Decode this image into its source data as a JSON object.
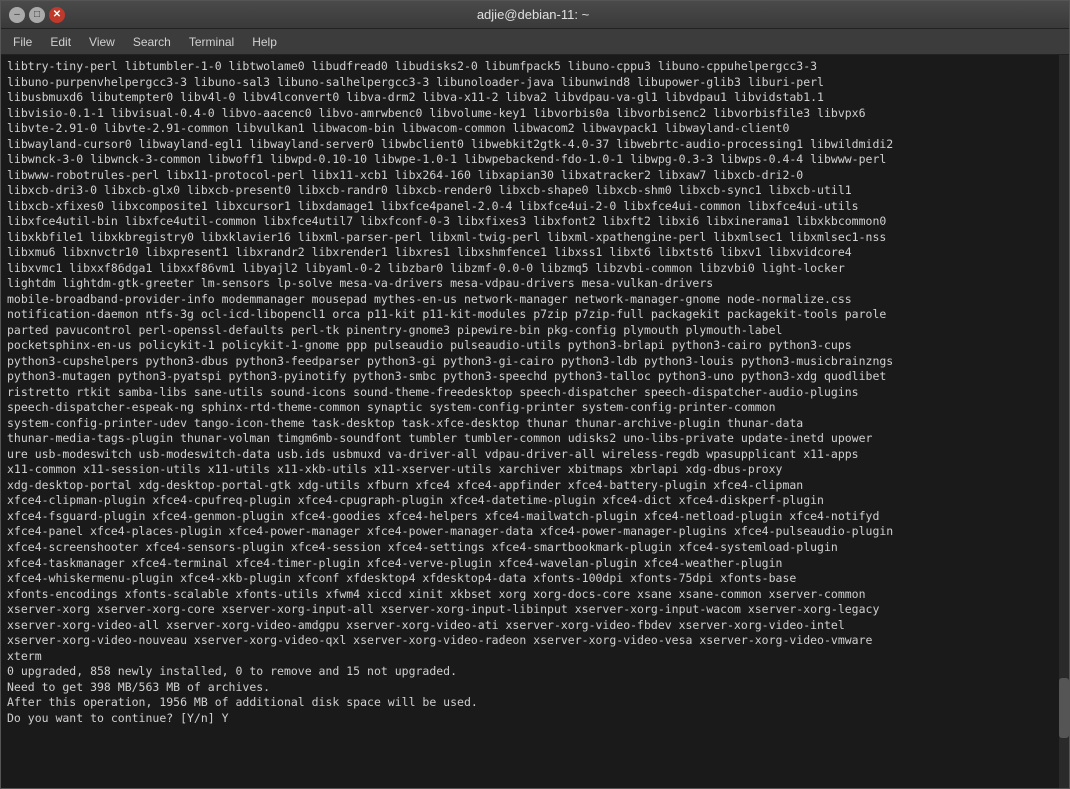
{
  "window": {
    "title": "adjie@debian-11: ~",
    "buttons": {
      "minimize": "–",
      "maximize": "□",
      "close": "✕"
    }
  },
  "menubar": {
    "items": [
      "File",
      "Edit",
      "View",
      "Search",
      "Terminal",
      "Help"
    ]
  },
  "terminal": {
    "content": "libtry-tiny-perl libtumbler-1-0 libtwolame0 libudfread0 libudisks2-0 libumfpack5 libuno-cppu3 libuno-cppuhelpergcc3-3\nlibuno-purpenvhelpergcc3-3 libuno-sal3 libuno-salhelpergcc3-3 libunoloader-java libunwind8 libupower-glib3 liburi-perl\nlibusbmuxd6 libutempter0 libv4l-0 libv4lconvert0 libva-drm2 libva-x11-2 libva2 libvdpau-va-gl1 libvdpau1 libvidstab1.1\nlibvisio-0.1-1 libvisual-0.4-0 libvo-aacenc0 libvo-amrwbenc0 libvolume-key1 libvorbis0a libvorbisenc2 libvorbisfile3 libvpx6\nlibvte-2.91-0 libvte-2.91-common libvulkan1 libwacom-bin libwacom-common libwacom2 libwavpack1 libwayland-client0\nlibwayland-cursor0 libwayland-egl1 libwayland-server0 libwbclient0 libwebkit2gtk-4.0-37 libwebrtc-audio-processing1 libwildmidi2\nlibwnck-3-0 libwnck-3-common libwoff1 libwpd-0.10-10 libwpe-1.0-1 libwpebackend-fdo-1.0-1 libwpg-0.3-3 libwps-0.4-4 libwww-perl\nlibwww-robotrules-perl libx11-protocol-perl libx11-xcb1 libx264-160 libxapian30 libxatracker2 libxaw7 libxcb-dri2-0\nlibxcb-dri3-0 libxcb-glx0 libxcb-present0 libxcb-randr0 libxcb-render0 libxcb-shape0 libxcb-shm0 libxcb-sync1 libxcb-util1\nlibxcb-xfixes0 libxcomposite1 libxcursor1 libxdamage1 libxfce4panel-2.0-4 libxfce4ui-2-0 libxfce4ui-common libxfce4ui-utils\nlibxfce4util-bin libxfce4util-common libxfce4util7 libxfconf-0-3 libxfixes3 libxfont2 libxft2 libxi6 libxinerama1 libxkbcommon0\nlibxkbfile1 libxkbregistry0 libxklavier16 libxml-parser-perl libxml-twig-perl libxml-xpathengine-perl libxmlsec1 libxmlsec1-nss\nlibxmu6 libxnvctr10 libxpresent1 libxrandr2 libxrender1 libxres1 libxshmfence1 libxss1 libxt6 libxtst6 libxv1 libxvidcore4\nlibxvmc1 libxxf86dga1 libxxf86vm1 libyajl2 libyaml-0-2 libzbar0 libzmf-0.0-0 libzmq5 libzvbi-common libzvbi0 light-locker\nlightdm lightdm-gtk-greeter lm-sensors lp-solve mesa-va-drivers mesa-vdpau-drivers mesa-vulkan-drivers\nmobile-broadband-provider-info modemmanager mousepad mythes-en-us network-manager network-manager-gnome node-normalize.css\nnotification-daemon ntfs-3g ocl-icd-libopencl1 orca p11-kit p11-kit-modules p7zip p7zip-full packagekit packagekit-tools parole\nparted pavucontrol perl-openssl-defaults perl-tk pinentry-gnome3 pipewire-bin pkg-config plymouth plymouth-label\npocketsphinx-en-us policykit-1 policykit-1-gnome ppp pulseaudio pulseaudio-utils python3-brlapi python3-cairo python3-cups\npython3-cupshelpers python3-dbus python3-feedparser python3-gi python3-gi-cairo python3-ldb python3-louis python3-musicbrainzngs\npython3-mutagen python3-pyatspi python3-pyinotify python3-smbc python3-speechd python3-talloc python3-uno python3-xdg quodlibet\nristretto rtkit samba-libs sane-utils sound-icons sound-theme-freedesktop speech-dispatcher speech-dispatcher-audio-plugins\nspeech-dispatcher-espeak-ng sphinx-rtd-theme-common synaptic system-config-printer system-config-printer-common\nsystem-config-printer-udev tango-icon-theme task-desktop task-xfce-desktop thunar thunar-archive-plugin thunar-data\nthunar-media-tags-plugin thunar-volman timgm6mb-soundfont tumbler tumbler-common udisks2 uno-libs-private update-inetd upower\nure usb-modeswitch usb-modeswitch-data usb.ids usbmuxd va-driver-all vdpau-driver-all wireless-regdb wpasupplicant x11-apps\nx11-common x11-session-utils x11-utils x11-xkb-utils x11-xserver-utils xarchiver xbitmaps xbrlapi xdg-dbus-proxy\nxdg-desktop-portal xdg-desktop-portal-gtk xdg-utils xfburn xfce4 xfce4-appfinder xfce4-battery-plugin xfce4-clipman\nxfce4-clipman-plugin xfce4-cpufreq-plugin xfce4-cpugraph-plugin xfce4-datetime-plugin xfce4-dict xfce4-diskperf-plugin\nxfce4-fsguard-plugin xfce4-genmon-plugin xfce4-goodies xfce4-helpers xfce4-mailwatch-plugin xfce4-netload-plugin xfce4-notifyd\nxfce4-panel xfce4-places-plugin xfce4-power-manager xfce4-power-manager-data xfce4-power-manager-plugins xfce4-pulseaudio-plugin\nxfce4-screenshooter xfce4-sensors-plugin xfce4-session xfce4-settings xfce4-smartbookmark-plugin xfce4-systemload-plugin\nxfce4-taskmanager xfce4-terminal xfce4-timer-plugin xfce4-verve-plugin xfce4-wavelan-plugin xfce4-weather-plugin\nxfce4-whiskermenu-plugin xfce4-xkb-plugin xfconf xfdesktop4 xfdesktop4-data xfonts-100dpi xfonts-75dpi xfonts-base\nxfonts-encodings xfonts-scalable xfonts-utils xfwm4 xiccd xinit xkbset xorg xorg-docs-core xsane xsane-common xserver-common\nxserver-xorg xserver-xorg-core xserver-xorg-input-all xserver-xorg-input-libinput xserver-xorg-input-wacom xserver-xorg-legacy\nxserver-xorg-video-all xserver-xorg-video-amdgpu xserver-xorg-video-ati xserver-xorg-video-fbdev xserver-xorg-video-intel\nxserver-xorg-video-nouveau xserver-xorg-video-qxl xserver-xorg-video-radeon xserver-xorg-video-vesa xserver-xorg-video-vmware\nxterm\n0 upgraded, 858 newly installed, 0 to remove and 15 not upgraded.\nNeed to get 398 MB/563 MB of archives.\nAfter this operation, 1956 MB of additional disk space will be used.\nDo you want to continue? [Y/n] Y"
  }
}
